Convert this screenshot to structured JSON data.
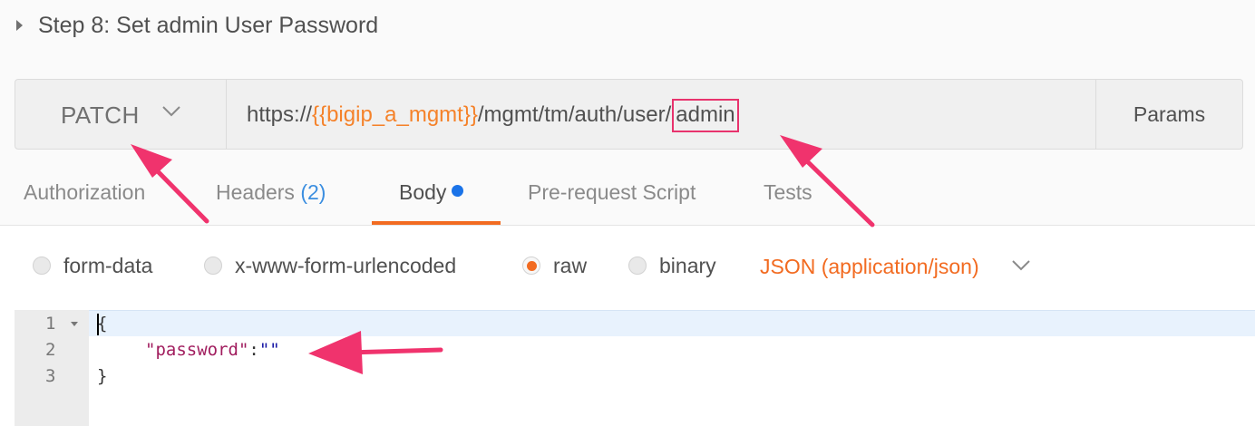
{
  "step": {
    "title": "Step 8: Set admin User Password",
    "caret_icon": "caret-right-icon"
  },
  "request": {
    "method": "PATCH",
    "url_prefix": "https://",
    "url_variable": "{{bigip_a_mgmt}}",
    "url_path": "/mgmt/tm/auth/user/",
    "url_highlighted": "admin",
    "params_label": "Params"
  },
  "tabs": {
    "authorization": "Authorization",
    "headers": "Headers",
    "headers_count": "(2)",
    "body": "Body",
    "pre_request": "Pre-request Script",
    "tests": "Tests",
    "active": "Body"
  },
  "body_modes": {
    "options": [
      "form-data",
      "x-www-form-urlencoded",
      "raw",
      "binary"
    ],
    "selected": "raw",
    "content_type": "JSON (application/json)"
  },
  "editor": {
    "line_numbers": [
      "1",
      "2",
      "3"
    ],
    "line1": "{",
    "key": "\"password\"",
    "colon": ":",
    "value": "\"\"",
    "line3": "}"
  },
  "colors": {
    "accent": "#f26b21",
    "variable": "#f5822a",
    "link_count": "#3b8ee0",
    "annotation": "#f0336d"
  }
}
